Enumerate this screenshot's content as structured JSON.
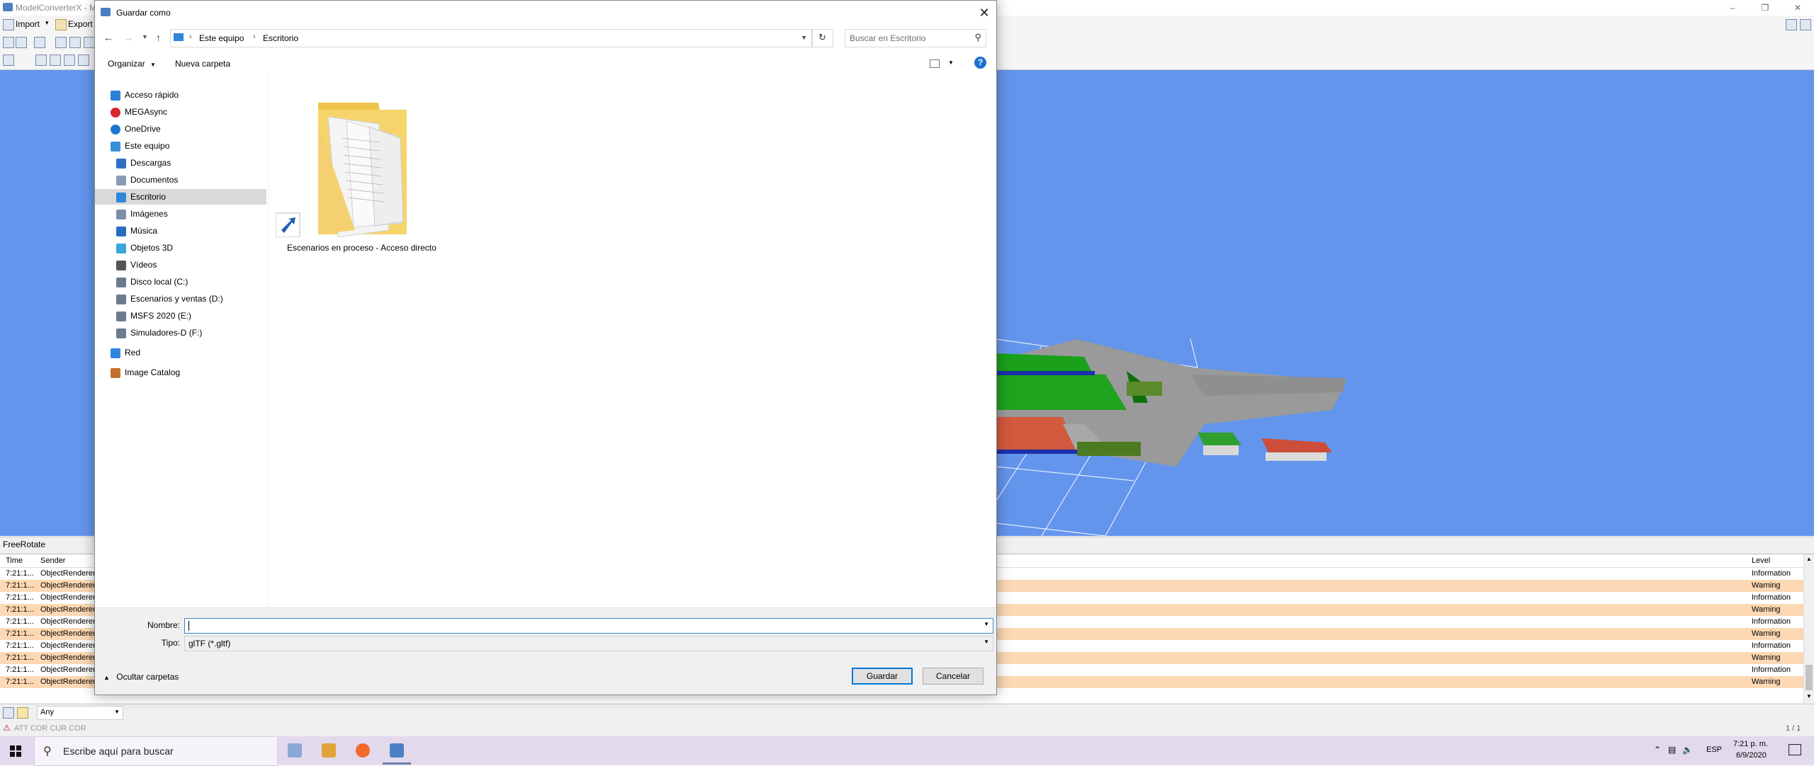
{
  "app": {
    "title": "ModelConverterX - M",
    "toolbar": {
      "import_label": "Import",
      "export_label": "Export"
    },
    "freerotate_label": "FreeRotate",
    "log": {
      "columns": {
        "time": "Time",
        "sender": "Sender",
        "level": "Level"
      },
      "rows": [
        {
          "time": "7:21:1...",
          "sender": "ObjectRenderer",
          "level": "Information",
          "warn": false
        },
        {
          "time": "7:21:1...",
          "sender": "ObjectRenderer",
          "level": "Warning",
          "warn": true
        },
        {
          "time": "7:21:1...",
          "sender": "ObjectRenderer",
          "level": "Information",
          "warn": false
        },
        {
          "time": "7:21:1...",
          "sender": "ObjectRenderer",
          "level": "Warning",
          "warn": true
        },
        {
          "time": "7:21:1...",
          "sender": "ObjectRenderer",
          "level": "Information",
          "warn": false
        },
        {
          "time": "7:21:1...",
          "sender": "ObjectRenderer",
          "level": "Warning",
          "warn": true
        },
        {
          "time": "7:21:1...",
          "sender": "ObjectRenderer",
          "level": "Information",
          "warn": false
        },
        {
          "time": "7:21:1...",
          "sender": "ObjectRenderer",
          "level": "Warning",
          "warn": true
        },
        {
          "time": "7:21:1...",
          "sender": "ObjectRenderer",
          "level": "Information",
          "warn": false
        },
        {
          "time": "7:21:1...",
          "sender": "ObjectRenderer",
          "level": "Warning",
          "warn": true
        }
      ]
    },
    "filter_value": "Any",
    "status_text": "ATT COR  CUR COR",
    "page_counter": "1 / 1"
  },
  "dialog": {
    "title": "Guardar como",
    "breadcrumb": [
      "Este equipo",
      "Escritorio"
    ],
    "search_placeholder": "Buscar en Escritorio",
    "organize_label": "Organizar",
    "new_folder_label": "Nueva carpeta",
    "nav": [
      {
        "label": "Acceso rápido",
        "icon": "star-icon",
        "color": "#2e7fd6",
        "level": 0
      },
      {
        "label": "MEGAsync",
        "icon": "mega-icon",
        "color": "#d9272e",
        "level": 0
      },
      {
        "label": "OneDrive",
        "icon": "cloud-icon",
        "color": "#1b78d1",
        "level": 0
      },
      {
        "label": "Este equipo",
        "icon": "computer-icon",
        "color": "#3a8ed8",
        "level": 0
      },
      {
        "label": "Descargas",
        "icon": "download-icon",
        "color": "#2f6fc4",
        "level": 1
      },
      {
        "label": "Documentos",
        "icon": "document-icon",
        "color": "#8a9bb5",
        "level": 1
      },
      {
        "label": "Escritorio",
        "icon": "desktop-icon",
        "color": "#2f86dd",
        "level": 1,
        "selected": true
      },
      {
        "label": "Imágenes",
        "icon": "pictures-icon",
        "color": "#7d8fa8",
        "level": 1
      },
      {
        "label": "Música",
        "icon": "music-icon",
        "color": "#2a6cc0",
        "level": 1
      },
      {
        "label": "Objetos 3D",
        "icon": "cube-icon",
        "color": "#3aa6d8",
        "level": 1
      },
      {
        "label": "Vídeos",
        "icon": "video-icon",
        "color": "#555555",
        "level": 1
      },
      {
        "label": "Disco local (C:)",
        "icon": "drive-icon",
        "color": "#6b7b8f",
        "level": 1
      },
      {
        "label": "Escenarios y ventas (D:)",
        "icon": "drive-icon",
        "color": "#6b7b8f",
        "level": 1
      },
      {
        "label": "MSFS 2020 (E:)",
        "icon": "drive-icon",
        "color": "#6b7b8f",
        "level": 1
      },
      {
        "label": "Simuladores-D (F:)",
        "icon": "drive-icon",
        "color": "#6b7b8f",
        "level": 1
      },
      {
        "label": "Red",
        "icon": "network-icon",
        "color": "#2f86dd",
        "level": 0
      },
      {
        "label": "Image Catalog",
        "icon": "catalog-icon",
        "color": "#c0702a",
        "level": 0
      }
    ],
    "file_item_label": "Escenarios en proceso - Acceso directo",
    "name_label": "Nombre:",
    "name_value": "",
    "type_label": "Tipo:",
    "type_value": "glTF (*.gltf)",
    "hide_folders_label": "Ocultar carpetas",
    "save_label": "Guardar",
    "cancel_label": "Cancelar"
  },
  "taskbar": {
    "search_placeholder": "Escribe aquí para buscar",
    "lang": "ESP",
    "time": "7:21 p. m.",
    "date": "6/9/2020"
  }
}
